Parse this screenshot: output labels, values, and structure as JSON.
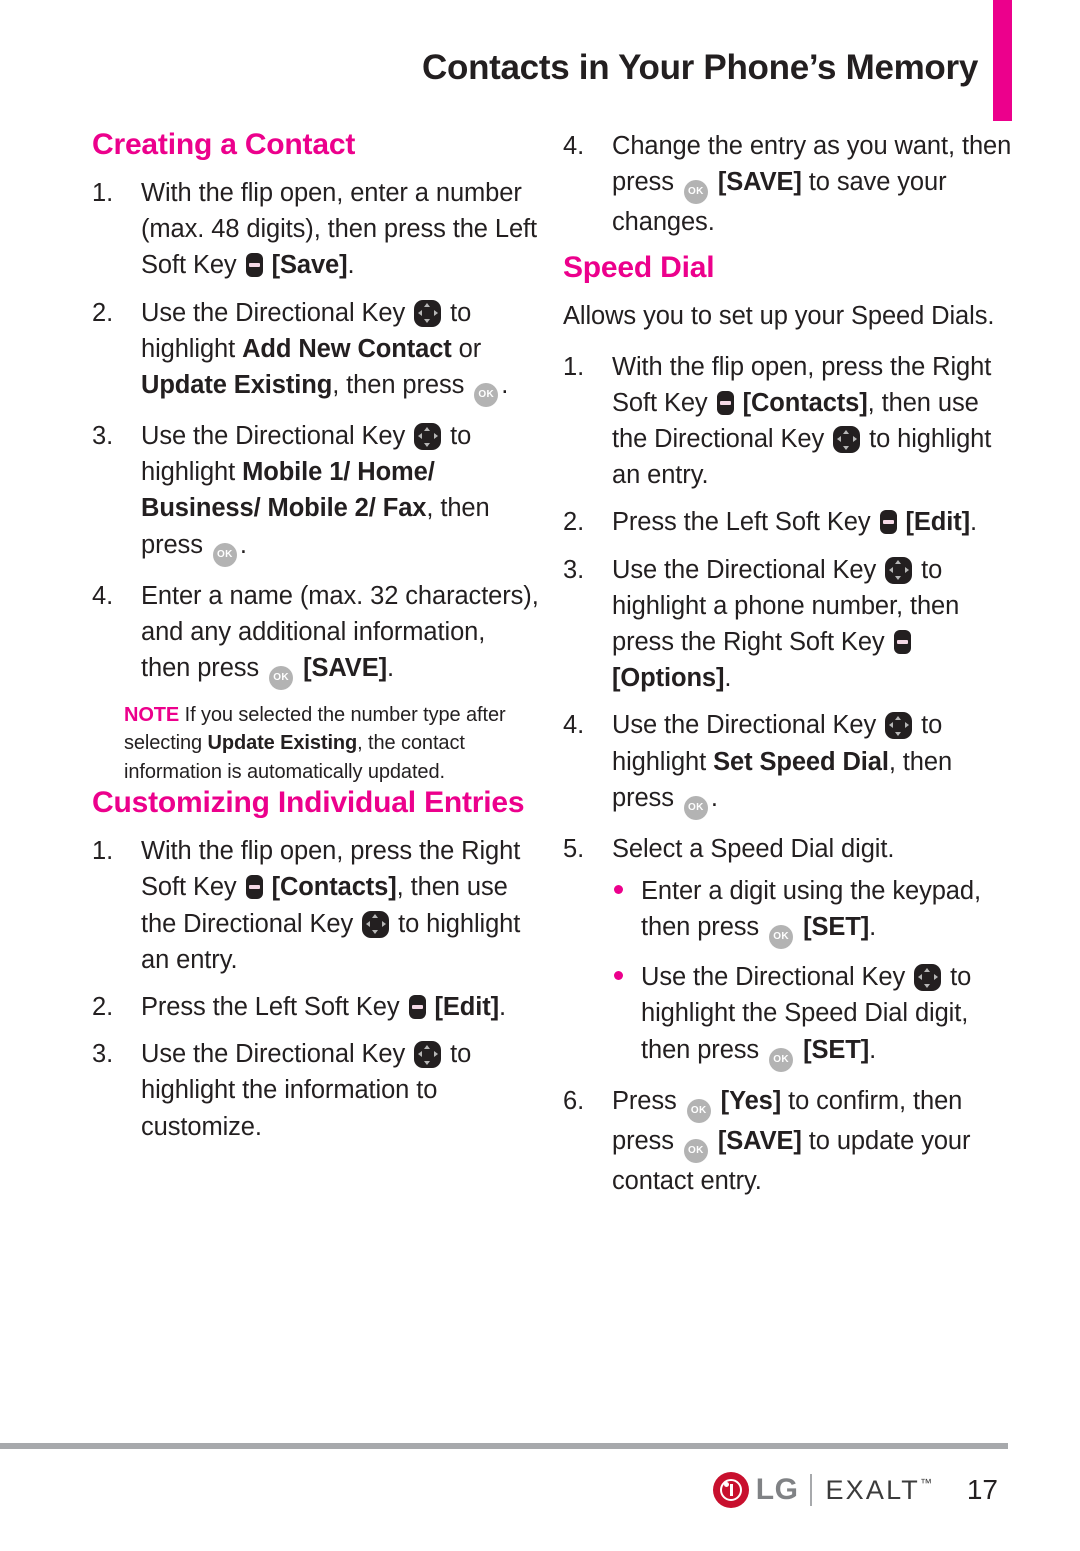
{
  "header": {
    "title": "Contacts in Your Phone’s Memory",
    "accent_color": "#ec008c"
  },
  "icons": {
    "soft_key": "soft-key-icon",
    "directional_key": "directional-key-icon",
    "ok_key": "ok-key-icon",
    "ok_label": "OK"
  },
  "left_column": {
    "heading_creating": "Creating a Contact",
    "steps_creating": [
      {
        "num": "1.",
        "parts": [
          {
            "t": "text",
            "v": "With the flip open, enter a number (max. 48 digits), then press the Left Soft Key "
          },
          {
            "t": "softkey"
          },
          {
            "t": "text",
            "v": " "
          },
          {
            "t": "bold",
            "v": "[Save]"
          },
          {
            "t": "text",
            "v": "."
          }
        ]
      },
      {
        "num": "2.",
        "parts": [
          {
            "t": "text",
            "v": "Use the Directional Key "
          },
          {
            "t": "dirkey"
          },
          {
            "t": "text",
            "v": " to highlight "
          },
          {
            "t": "bold",
            "v": "Add New Contact"
          },
          {
            "t": "text",
            "v": " or "
          },
          {
            "t": "bold",
            "v": "Update Existing"
          },
          {
            "t": "text",
            "v": ", then press "
          },
          {
            "t": "okkey"
          },
          {
            "t": "text",
            "v": "."
          }
        ]
      },
      {
        "num": "3.",
        "parts": [
          {
            "t": "text",
            "v": "Use the Directional Key "
          },
          {
            "t": "dirkey"
          },
          {
            "t": "text",
            "v": " to highlight "
          },
          {
            "t": "bold",
            "v": "Mobile 1/ Home/ Business/ Mobile 2/ Fax"
          },
          {
            "t": "text",
            "v": ", then press "
          },
          {
            "t": "okkey"
          },
          {
            "t": "text",
            "v": "."
          }
        ]
      },
      {
        "num": "4.",
        "parts": [
          {
            "t": "text",
            "v": "Enter a name (max. 32 characters), and any additional information, then press "
          },
          {
            "t": "okkey"
          },
          {
            "t": "text",
            "v": " "
          },
          {
            "t": "bold",
            "v": "[SAVE]"
          },
          {
            "t": "text",
            "v": "."
          }
        ]
      }
    ],
    "note": {
      "label": "NOTE",
      "parts": [
        {
          "t": "text",
          "v": " If you selected the number type after selecting "
        },
        {
          "t": "bold",
          "v": "Update Existing"
        },
        {
          "t": "text",
          "v": ", the contact information is automatically updated."
        }
      ]
    },
    "heading_customizing": "Customizing Individual Entries",
    "steps_customizing": [
      {
        "num": "1.",
        "parts": [
          {
            "t": "text",
            "v": "With the flip open, press the Right Soft Key "
          },
          {
            "t": "softkey"
          },
          {
            "t": "text",
            "v": " "
          },
          {
            "t": "bold",
            "v": "[Contacts]"
          },
          {
            "t": "text",
            "v": ", then use the Directional Key "
          },
          {
            "t": "dirkey"
          },
          {
            "t": "text",
            "v": " to highlight an entry."
          }
        ]
      },
      {
        "num": "2.",
        "parts": [
          {
            "t": "text",
            "v": "Press the Left Soft Key "
          },
          {
            "t": "softkey"
          },
          {
            "t": "text",
            "v": " "
          },
          {
            "t": "bold",
            "v": "[Edit]"
          },
          {
            "t": "text",
            "v": "."
          }
        ]
      },
      {
        "num": "3.",
        "parts": [
          {
            "t": "text",
            "v": "Use the Directional Key "
          },
          {
            "t": "dirkey"
          },
          {
            "t": "text",
            "v": " to highlight the information to customize."
          }
        ]
      }
    ]
  },
  "right_column": {
    "step_continued": {
      "num": "4.",
      "parts": [
        {
          "t": "text",
          "v": "Change the entry as you want, then press "
        },
        {
          "t": "okkey"
        },
        {
          "t": "text",
          "v": " "
        },
        {
          "t": "bold",
          "v": "[SAVE]"
        },
        {
          "t": "text",
          "v": " to save your changes."
        }
      ]
    },
    "heading_speed_dial": "Speed Dial",
    "intro": "Allows you to set up your Speed Dials.",
    "steps_speed_dial": [
      {
        "num": "1.",
        "parts": [
          {
            "t": "text",
            "v": "With the flip open, press the Right Soft Key "
          },
          {
            "t": "softkey"
          },
          {
            "t": "text",
            "v": " "
          },
          {
            "t": "bold",
            "v": "[Contacts]"
          },
          {
            "t": "text",
            "v": ", then use the Directional Key "
          },
          {
            "t": "dirkey"
          },
          {
            "t": "text",
            "v": " to highlight an entry."
          }
        ]
      },
      {
        "num": "2.",
        "parts": [
          {
            "t": "text",
            "v": "Press the Left Soft Key "
          },
          {
            "t": "softkey"
          },
          {
            "t": "text",
            "v": " "
          },
          {
            "t": "bold",
            "v": "[Edit]"
          },
          {
            "t": "text",
            "v": "."
          }
        ]
      },
      {
        "num": "3.",
        "parts": [
          {
            "t": "text",
            "v": "Use the Directional Key "
          },
          {
            "t": "dirkey"
          },
          {
            "t": "text",
            "v": " to highlight a phone number, then press the Right Soft Key "
          },
          {
            "t": "softkey"
          },
          {
            "t": "text",
            "v": " "
          },
          {
            "t": "bold",
            "v": "[Options]"
          },
          {
            "t": "text",
            "v": "."
          }
        ]
      },
      {
        "num": "4.",
        "parts": [
          {
            "t": "text",
            "v": "Use the Directional Key "
          },
          {
            "t": "dirkey"
          },
          {
            "t": "text",
            "v": " to highlight "
          },
          {
            "t": "bold",
            "v": "Set Speed Dial"
          },
          {
            "t": "text",
            "v": ", then press "
          },
          {
            "t": "okkey"
          },
          {
            "t": "text",
            "v": "."
          }
        ]
      },
      {
        "num": "5.",
        "parts": [
          {
            "t": "text",
            "v": "Select a Speed Dial digit."
          }
        ],
        "bullets": [
          {
            "parts": [
              {
                "t": "text",
                "v": "Enter a digit using the keypad, then press "
              },
              {
                "t": "okkey"
              },
              {
                "t": "text",
                "v": " "
              },
              {
                "t": "bold",
                "v": "[SET]"
              },
              {
                "t": "text",
                "v": "."
              }
            ]
          },
          {
            "parts": [
              {
                "t": "text",
                "v": "Use the Directional Key "
              },
              {
                "t": "dirkey"
              },
              {
                "t": "text",
                "v": " to highlight the Speed Dial digit, then press "
              },
              {
                "t": "okkey"
              },
              {
                "t": "text",
                "v": " "
              },
              {
                "t": "bold",
                "v": "[SET]"
              },
              {
                "t": "text",
                "v": "."
              }
            ]
          }
        ]
      },
      {
        "num": "6.",
        "parts": [
          {
            "t": "text",
            "v": "Press "
          },
          {
            "t": "okkey"
          },
          {
            "t": "text",
            "v": " "
          },
          {
            "t": "bold",
            "v": "[Yes]"
          },
          {
            "t": "text",
            "v": " to confirm, then press "
          },
          {
            "t": "okkey"
          },
          {
            "t": "text",
            "v": " "
          },
          {
            "t": "bold",
            "v": "[SAVE]"
          },
          {
            "t": "text",
            "v": " to update your contact entry."
          }
        ]
      }
    ]
  },
  "footer": {
    "brand": "LG",
    "product": "EXALT",
    "trademark": "™",
    "page_number": "17"
  }
}
